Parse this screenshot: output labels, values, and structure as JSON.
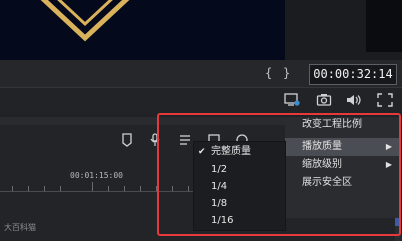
{
  "player": {
    "left_marker": "{",
    "right_marker": "}",
    "timecode": "00:00:32:14"
  },
  "controls": {
    "icons": [
      "display-settings-icon",
      "snapshot-icon",
      "volume-icon",
      "fullscreen-icon"
    ]
  },
  "timeline": {
    "ruler_label": "00:01:15:00",
    "track_icons": [
      "marker-icon",
      "mic-icon",
      "mixer-icon",
      "crop-icon",
      "speed-icon"
    ]
  },
  "watermark": "大百科猫",
  "context_menu": {
    "items": [
      {
        "label": "改变工程比例",
        "has_submenu": false
      },
      {
        "label": "播放质量",
        "has_submenu": true
      },
      {
        "label": "缩放级别",
        "has_submenu": true
      },
      {
        "label": "展示安全区",
        "has_submenu": false
      }
    ],
    "arrow": "▶"
  },
  "quality_submenu": {
    "check": "✔",
    "items": [
      {
        "label": "完整质量",
        "checked": true
      },
      {
        "label": "1/2",
        "checked": false
      },
      {
        "label": "1/4",
        "checked": false
      },
      {
        "label": "1/8",
        "checked": false
      },
      {
        "label": "1/16",
        "checked": false
      }
    ]
  },
  "colors": {
    "accent_red": "#e5393b",
    "gold": "#d9b25b",
    "preview_bg": "#04091c"
  }
}
